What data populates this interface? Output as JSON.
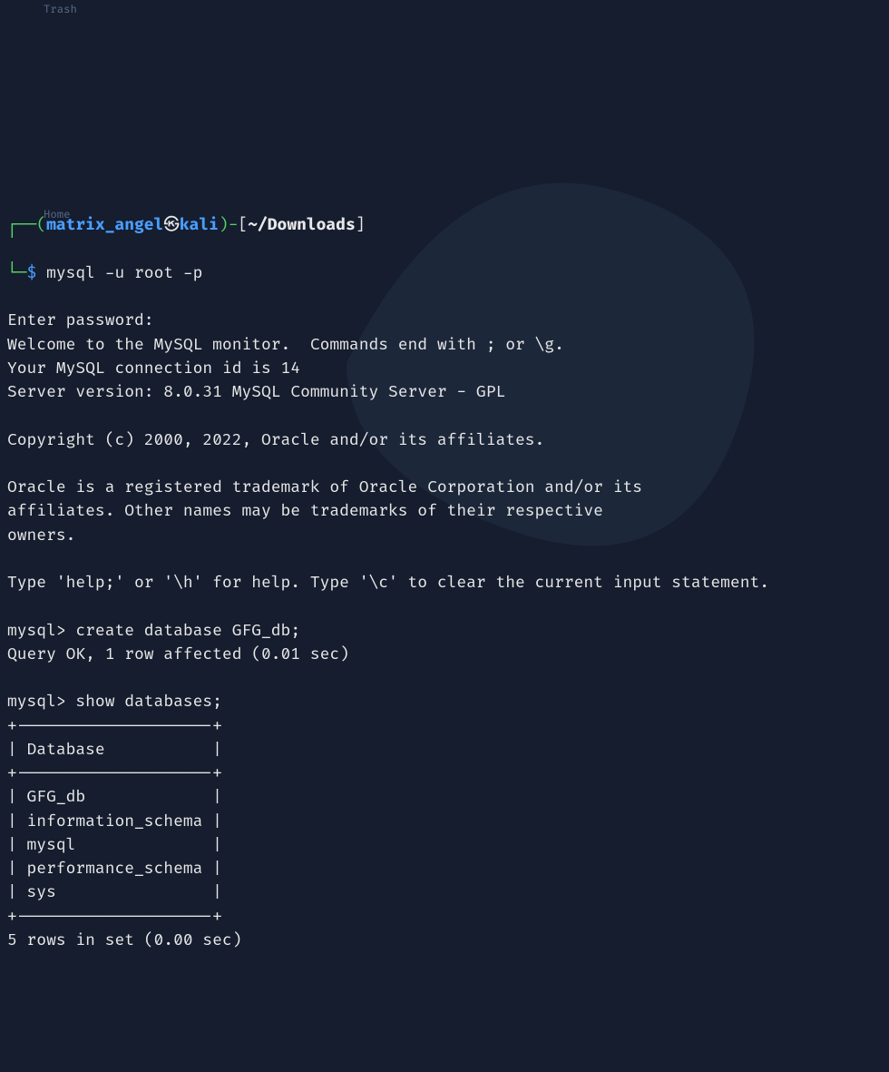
{
  "desktop": {
    "icon1_label": "Trash",
    "icon2_label": "Home"
  },
  "prompt": {
    "corner_top": "┌──",
    "paren_open": "(",
    "user": "matrix_angel",
    "at": "㉿",
    "host": "kali",
    "paren_close": ")",
    "dash": "-",
    "bracket_open": "[",
    "path": "~/Downloads",
    "bracket_close": "]",
    "corner_bot": "└─",
    "dollar": "$"
  },
  "cmd1": "mysql -u root -p",
  "out": {
    "l1": "Enter password:",
    "l2": "Welcome to the MySQL monitor.  Commands end with ; or \\g.",
    "l3": "Your MySQL connection id is 14",
    "l4": "Server version: 8.0.31 MySQL Community Server - GPL",
    "l5": "",
    "l6": "Copyright (c) 2000, 2022, Oracle and/or its affiliates.",
    "l7": "",
    "l8": "Oracle is a registered trademark of Oracle Corporation and/or its",
    "l9": "affiliates. Other names may be trademarks of their respective",
    "l10": "owners.",
    "l11": "",
    "l12": "Type 'help;' or '\\h' for help. Type '\\c' to clear the current input statement.",
    "l13": ""
  },
  "mysql": {
    "prompt": "mysql> ",
    "cmd1": "create database GFG_db;",
    "res1": "Query OK, 1 row affected (0.01 sec)",
    "blank": "",
    "cmd2": "show databases;",
    "tbl_top": "+--------------------+",
    "tbl_head": "| Database           |",
    "tbl_sep": "+--------------------+",
    "tbl_r1": "| GFG_db             |",
    "tbl_r2": "| information_schema |",
    "tbl_r3": "| mysql              |",
    "tbl_r4": "| performance_schema |",
    "tbl_r5": "| sys                |",
    "tbl_bot": "+--------------------+",
    "res2": "5 rows in set (0.00 sec)"
  }
}
